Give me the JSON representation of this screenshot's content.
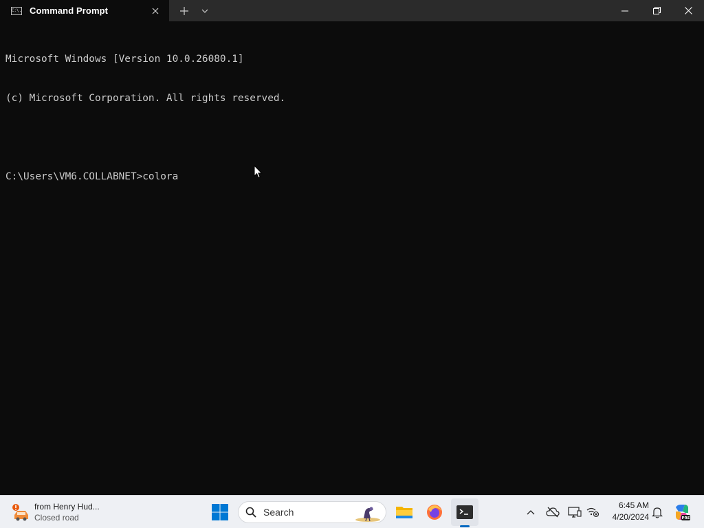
{
  "window": {
    "tab_title": "Command Prompt",
    "tab_icon_text": "C:\\.",
    "new_tab_glyph": "+",
    "close_glyph": "✕"
  },
  "console": {
    "lines": [
      "Microsoft Windows [Version 10.0.26080.1]",
      "(c) Microsoft Corporation. All rights reserved.",
      "",
      "C:\\Users\\VM6.COLLABNET>colora"
    ]
  },
  "taskbar": {
    "widget_title": "from Henry Hud...",
    "widget_subtitle": "Closed road",
    "search_placeholder": "Search",
    "apps": [
      "start-icon",
      "search",
      "file-explorer-icon",
      "firefox-icon",
      "terminal-icon"
    ],
    "tray_icons": [
      "chevron-up-icon",
      "onedrive-offline-icon",
      "display-icon",
      "network-icon",
      "notification-bell-icon",
      "copilot-icon"
    ],
    "time": "6:45 AM",
    "date": "4/20/2024",
    "accent_color": "#0067c0"
  }
}
